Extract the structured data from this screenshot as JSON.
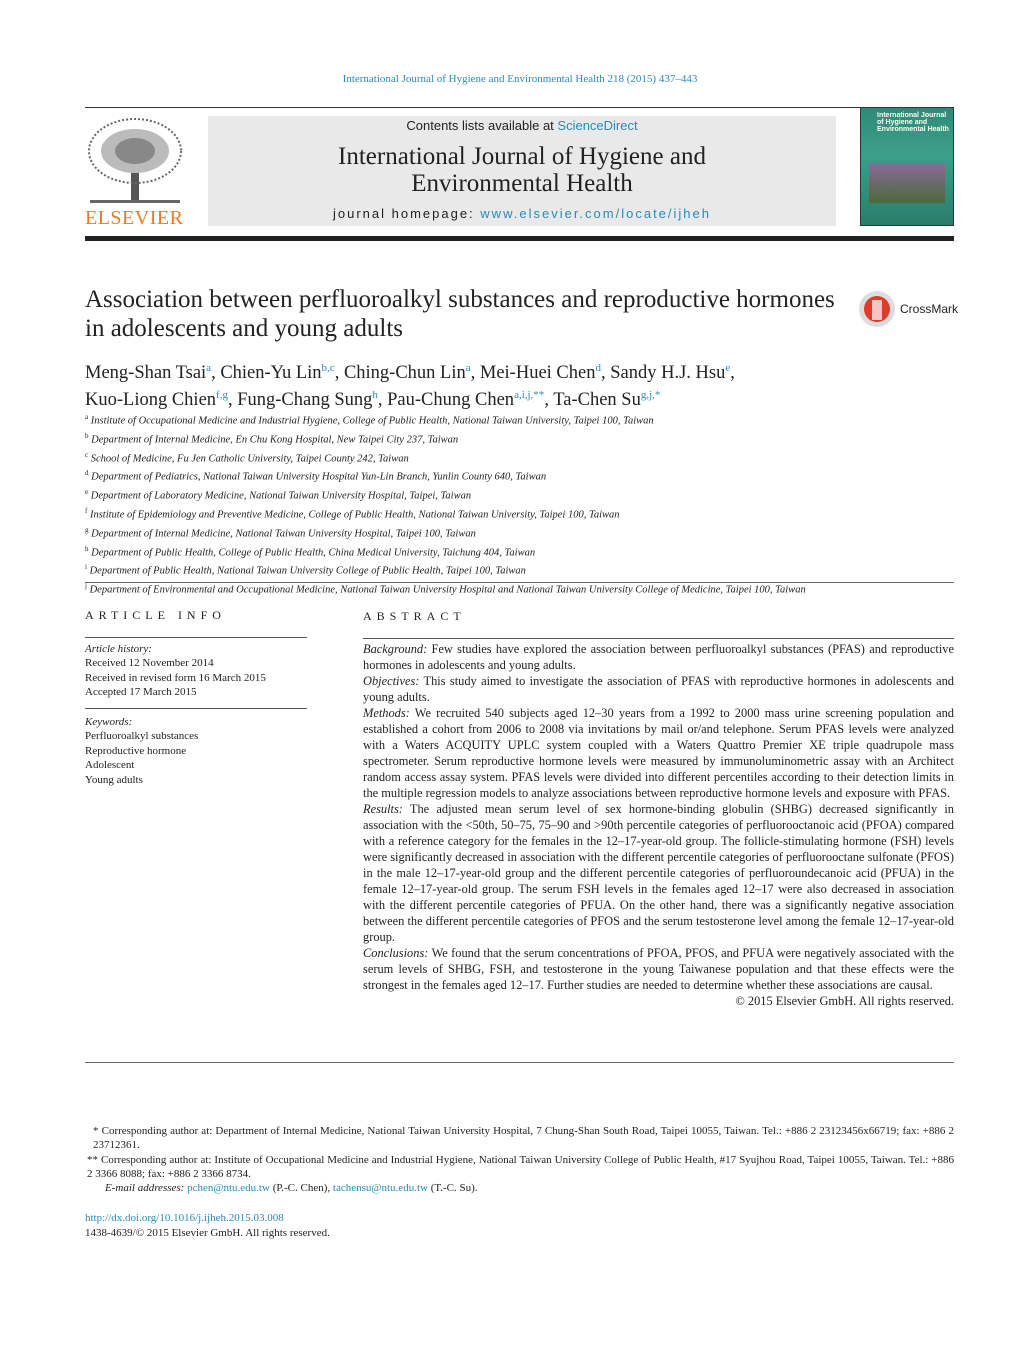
{
  "header": {
    "citation": "International Journal of Hygiene and Environmental Health 218 (2015) 437–443",
    "contents_prefix": "Contents lists available at ",
    "contents_link": "ScienceDirect",
    "journal_title": "International Journal of Hygiene and Environmental Health",
    "homepage_prefix": "journal homepage: ",
    "homepage_link": "www.elsevier.com/locate/ijheh",
    "publisher": "ELSEVIER",
    "cover_title": "International Journal of Hygiene and Environmental Health"
  },
  "article": {
    "title": "Association between perfluoroalkyl substances and reproductive hormones in adolescents and young adults",
    "crossmark": "CrossMark",
    "authors": [
      {
        "name": "Meng-Shan Tsai",
        "sup": "a"
      },
      {
        "name": "Chien-Yu Lin",
        "sup": "b,c"
      },
      {
        "name": "Ching-Chun Lin",
        "sup": "a"
      },
      {
        "name": "Mei-Huei Chen",
        "sup": "d"
      },
      {
        "name": "Sandy H.J. Hsu",
        "sup": "e"
      },
      {
        "name": "Kuo-Liong Chien",
        "sup": "f,g"
      },
      {
        "name": "Fung-Chang Sung",
        "sup": "h"
      },
      {
        "name": "Pau-Chung Chen",
        "sup": "a,i,j,**"
      },
      {
        "name": "Ta-Chen Su",
        "sup": "g,j,*"
      }
    ],
    "affiliations": [
      {
        "k": "a",
        "t": "Institute of Occupational Medicine and Industrial Hygiene, College of Public Health, National Taiwan University, Taipei 100, Taiwan"
      },
      {
        "k": "b",
        "t": "Department of Internal Medicine, En Chu Kong Hospital, New Taipei City 237, Taiwan"
      },
      {
        "k": "c",
        "t": "School of Medicine, Fu Jen Catholic University, Taipei County 242, Taiwan"
      },
      {
        "k": "d",
        "t": "Department of Pediatrics, National Taiwan University Hospital Yun-Lin Branch, Yunlin County 640, Taiwan"
      },
      {
        "k": "e",
        "t": "Department of Laboratory Medicine, National Taiwan University Hospital, Taipei, Taiwan"
      },
      {
        "k": "f",
        "t": "Institute of Epidemiology and Preventive Medicine, College of Public Health, National Taiwan University, Taipei 100, Taiwan"
      },
      {
        "k": "g",
        "t": "Department of Internal Medicine, National Taiwan University Hospital, Taipei 100, Taiwan"
      },
      {
        "k": "h",
        "t": "Department of Public Health, College of Public Health, China Medical University, Taichung 404, Taiwan"
      },
      {
        "k": "i",
        "t": "Department of Public Health, National Taiwan University College of Public Health, Taipei 100, Taiwan"
      },
      {
        "k": "j",
        "t": "Department of Environmental and Occupational Medicine, National Taiwan University Hospital and National Taiwan University College of Medicine, Taipei 100, Taiwan"
      }
    ]
  },
  "article_info": {
    "heading": "ARTICLE INFO",
    "history_label": "Article history:",
    "history": [
      "Received 12 November 2014",
      "Received in revised form 16 March 2015",
      "Accepted 17 March 2015"
    ],
    "keywords_label": "Keywords:",
    "keywords": [
      "Perfluoroalkyl substances",
      "Reproductive hormone",
      "Adolescent",
      "Young adults"
    ]
  },
  "abstract": {
    "heading": "ABSTRACT",
    "sections": [
      {
        "label": "Background:",
        "text": "Few studies have explored the association between perfluoroalkyl substances (PFAS) and reproductive hormones in adolescents and young adults."
      },
      {
        "label": "Objectives:",
        "text": "This study aimed to investigate the association of PFAS with reproductive hormones in adolescents and young adults."
      },
      {
        "label": "Methods:",
        "text": "We recruited 540 subjects aged 12–30 years from a 1992 to 2000 mass urine screening population and established a cohort from 2006 to 2008 via invitations by mail or/and telephone. Serum PFAS levels were analyzed with a Waters ACQUITY UPLC system coupled with a Waters Quattro Premier XE triple quadrupole mass spectrometer. Serum reproductive hormone levels were measured by immunoluminometric assay with an Architect random access assay system. PFAS levels were divided into different percentiles according to their detection limits in the multiple regression models to analyze associations between reproductive hormone levels and exposure with PFAS."
      },
      {
        "label": "Results:",
        "text": "The adjusted mean serum level of sex hormone-binding globulin (SHBG) decreased significantly in association with the <50th, 50–75, 75–90 and >90th percentile categories of perfluorooctanoic acid (PFOA) compared with a reference category for the females in the 12–17-year-old group. The follicle-stimulating hormone (FSH) levels were significantly decreased in association with the different percentile categories of perfluorooctane sulfonate (PFOS) in the male 12–17-year-old group and the different percentile categories of perfluoroundecanoic acid (PFUA) in the female 12–17-year-old group. The serum FSH levels in the females aged 12–17 were also decreased in association with the different percentile categories of PFUA. On the other hand, there was a significantly negative association between the different percentile categories of PFOS and the serum testosterone level among the female 12–17-year-old group."
      },
      {
        "label": "Conclusions:",
        "text": "We found that the serum concentrations of PFOA, PFOS, and PFUA were negatively associated with the serum levels of SHBG, FSH, and testosterone in the young Taiwanese population and that these effects were the strongest in the females aged 12–17. Further studies are needed to determine whether these associations are causal."
      }
    ],
    "copyright": "© 2015 Elsevier GmbH. All rights reserved."
  },
  "footnotes": {
    "star1": "* Corresponding author at: Department of Internal Medicine, National Taiwan University Hospital, 7 Chung-Shan South Road, Taipei 10055, Taiwan. Tel.: +886 2 23123456x66719; fax: +886 2 23712361.",
    "star2": "** Corresponding author at: Institute of Occupational Medicine and Industrial Hygiene, National Taiwan University College of Public Health, #17 Syujhou Road, Taipei 10055, Taiwan. Tel.: +886 2 3366 8088; fax: +886 2 3366 8734.",
    "email_label": "E-mail addresses:",
    "email1": "pchen@ntu.edu.tw",
    "email1_who": " (P.-C. Chen), ",
    "email2": "tachensu@ntu.edu.tw",
    "email2_who": " (T.-C. Su).",
    "doi": "http://dx.doi.org/10.1016/j.ijheh.2015.03.008",
    "issn": "1438-4639/© 2015 Elsevier GmbH. All rights reserved."
  }
}
